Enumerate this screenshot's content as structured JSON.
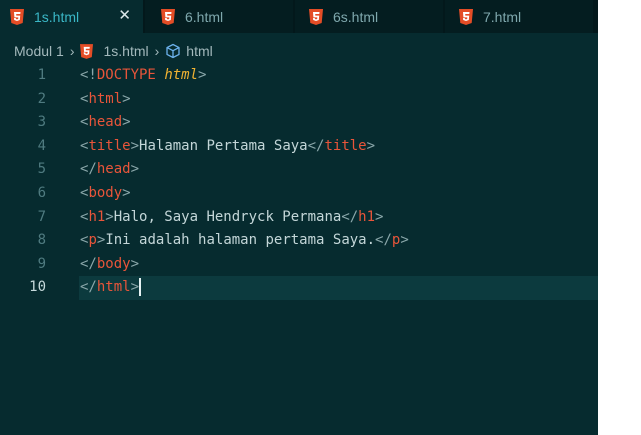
{
  "tabs": [
    {
      "label": "1s.html",
      "active": true,
      "close": "✕"
    },
    {
      "label": "6.html",
      "active": false
    },
    {
      "label": "6s.html",
      "active": false
    },
    {
      "label": "7.html",
      "active": false
    }
  ],
  "breadcrumb": {
    "folder": "Modul 1",
    "file": "1s.html",
    "symbol": "html"
  },
  "code": {
    "line_numbers": [
      "1",
      "2",
      "3",
      "4",
      "5",
      "6",
      "7",
      "8",
      "9",
      "10"
    ],
    "doctype_kw": "DOCTYPE",
    "doctype_attr": "html",
    "tags": {
      "html": "html",
      "head": "head",
      "title": "title",
      "body": "body",
      "h1": "h1",
      "p": "p"
    },
    "title_text": "Halaman Pertama Saya",
    "h1_text": "Halo, Saya Hendryck Permana",
    "p_text": "Ini adalah halaman pertama Saya."
  },
  "colors": {
    "background": "#062b2f",
    "tag": "#e8553a",
    "attribute": "#f0b232",
    "text": "#c3d6d8",
    "html5_badge": "#e44d26"
  }
}
